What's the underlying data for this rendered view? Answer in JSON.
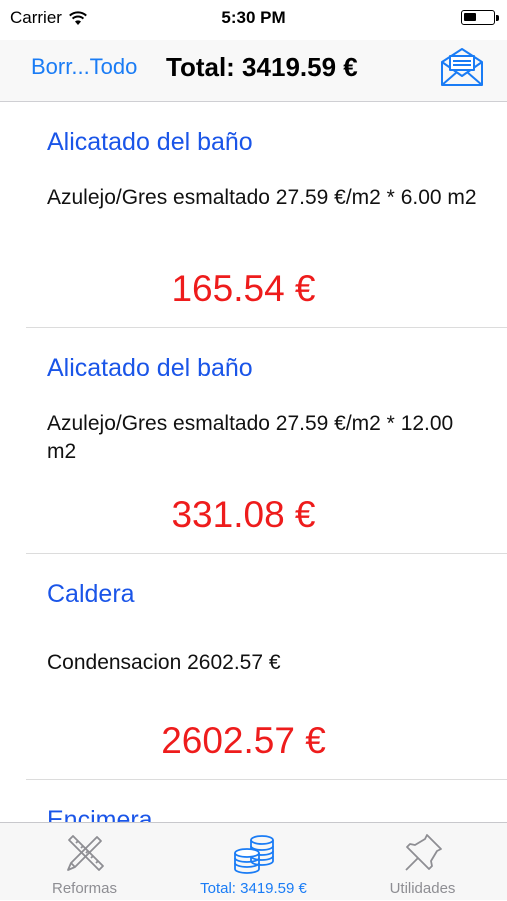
{
  "status_bar": {
    "carrier": "Carrier",
    "time": "5:30 PM"
  },
  "nav": {
    "left_button": "Borr...Todo",
    "title": "Total: 3419.59 €",
    "mail_icon": "envelope-icon"
  },
  "items": [
    {
      "title": "Alicatado del baño",
      "description": "Azulejo/Gres esmaltado 27.59 €/m2 * 6.00 m2",
      "amount": "165.54 €"
    },
    {
      "title": "Alicatado del baño",
      "description": "Azulejo/Gres esmaltado 27.59 €/m2 * 12.00 m2",
      "amount": "331.08 €"
    },
    {
      "title": "Caldera",
      "description": "Condensacion 2602.57 €",
      "amount": "2602.57 €"
    },
    {
      "title": "Encimera"
    }
  ],
  "tabs": [
    {
      "label": "Reformas",
      "icon": "ruler-pencil-icon",
      "active": false
    },
    {
      "label": "Total: 3419.59 €",
      "icon": "coins-icon",
      "active": true
    },
    {
      "label": "Utilidades",
      "icon": "pushpin-icon",
      "active": false
    }
  ],
  "colors": {
    "accent": "#1a7cf5",
    "item_title": "#1a55e8",
    "amount": "#ee1c1c"
  }
}
